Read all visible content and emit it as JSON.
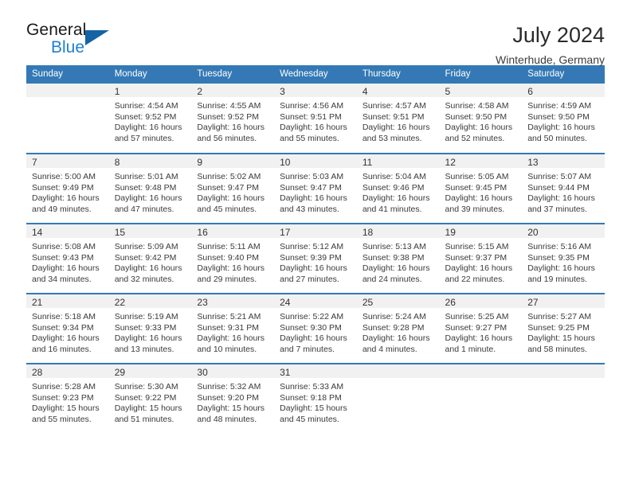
{
  "brand": {
    "name_part1": "General",
    "name_part2": "Blue",
    "triangle_color": "#1464a5",
    "blue_color": "#1f7fd0"
  },
  "header": {
    "title": "July 2024",
    "subtitle": "Winterhude, Germany"
  },
  "theme": {
    "header_row_bg": "#3479b5",
    "daynum_bg": "#f1f1f1",
    "rule_color": "#3479b5"
  },
  "weekdays": [
    "Sunday",
    "Monday",
    "Tuesday",
    "Wednesday",
    "Thursday",
    "Friday",
    "Saturday"
  ],
  "weeks": [
    [
      {
        "day": "",
        "sunrise": "",
        "sunset": "",
        "daylight_line1": "",
        "daylight_line2": ""
      },
      {
        "day": "1",
        "sunrise": "Sunrise: 4:54 AM",
        "sunset": "Sunset: 9:52 PM",
        "daylight_line1": "Daylight: 16 hours",
        "daylight_line2": "and 57 minutes."
      },
      {
        "day": "2",
        "sunrise": "Sunrise: 4:55 AM",
        "sunset": "Sunset: 9:52 PM",
        "daylight_line1": "Daylight: 16 hours",
        "daylight_line2": "and 56 minutes."
      },
      {
        "day": "3",
        "sunrise": "Sunrise: 4:56 AM",
        "sunset": "Sunset: 9:51 PM",
        "daylight_line1": "Daylight: 16 hours",
        "daylight_line2": "and 55 minutes."
      },
      {
        "day": "4",
        "sunrise": "Sunrise: 4:57 AM",
        "sunset": "Sunset: 9:51 PM",
        "daylight_line1": "Daylight: 16 hours",
        "daylight_line2": "and 53 minutes."
      },
      {
        "day": "5",
        "sunrise": "Sunrise: 4:58 AM",
        "sunset": "Sunset: 9:50 PM",
        "daylight_line1": "Daylight: 16 hours",
        "daylight_line2": "and 52 minutes."
      },
      {
        "day": "6",
        "sunrise": "Sunrise: 4:59 AM",
        "sunset": "Sunset: 9:50 PM",
        "daylight_line1": "Daylight: 16 hours",
        "daylight_line2": "and 50 minutes."
      }
    ],
    [
      {
        "day": "7",
        "sunrise": "Sunrise: 5:00 AM",
        "sunset": "Sunset: 9:49 PM",
        "daylight_line1": "Daylight: 16 hours",
        "daylight_line2": "and 49 minutes."
      },
      {
        "day": "8",
        "sunrise": "Sunrise: 5:01 AM",
        "sunset": "Sunset: 9:48 PM",
        "daylight_line1": "Daylight: 16 hours",
        "daylight_line2": "and 47 minutes."
      },
      {
        "day": "9",
        "sunrise": "Sunrise: 5:02 AM",
        "sunset": "Sunset: 9:47 PM",
        "daylight_line1": "Daylight: 16 hours",
        "daylight_line2": "and 45 minutes."
      },
      {
        "day": "10",
        "sunrise": "Sunrise: 5:03 AM",
        "sunset": "Sunset: 9:47 PM",
        "daylight_line1": "Daylight: 16 hours",
        "daylight_line2": "and 43 minutes."
      },
      {
        "day": "11",
        "sunrise": "Sunrise: 5:04 AM",
        "sunset": "Sunset: 9:46 PM",
        "daylight_line1": "Daylight: 16 hours",
        "daylight_line2": "and 41 minutes."
      },
      {
        "day": "12",
        "sunrise": "Sunrise: 5:05 AM",
        "sunset": "Sunset: 9:45 PM",
        "daylight_line1": "Daylight: 16 hours",
        "daylight_line2": "and 39 minutes."
      },
      {
        "day": "13",
        "sunrise": "Sunrise: 5:07 AM",
        "sunset": "Sunset: 9:44 PM",
        "daylight_line1": "Daylight: 16 hours",
        "daylight_line2": "and 37 minutes."
      }
    ],
    [
      {
        "day": "14",
        "sunrise": "Sunrise: 5:08 AM",
        "sunset": "Sunset: 9:43 PM",
        "daylight_line1": "Daylight: 16 hours",
        "daylight_line2": "and 34 minutes."
      },
      {
        "day": "15",
        "sunrise": "Sunrise: 5:09 AM",
        "sunset": "Sunset: 9:42 PM",
        "daylight_line1": "Daylight: 16 hours",
        "daylight_line2": "and 32 minutes."
      },
      {
        "day": "16",
        "sunrise": "Sunrise: 5:11 AM",
        "sunset": "Sunset: 9:40 PM",
        "daylight_line1": "Daylight: 16 hours",
        "daylight_line2": "and 29 minutes."
      },
      {
        "day": "17",
        "sunrise": "Sunrise: 5:12 AM",
        "sunset": "Sunset: 9:39 PM",
        "daylight_line1": "Daylight: 16 hours",
        "daylight_line2": "and 27 minutes."
      },
      {
        "day": "18",
        "sunrise": "Sunrise: 5:13 AM",
        "sunset": "Sunset: 9:38 PM",
        "daylight_line1": "Daylight: 16 hours",
        "daylight_line2": "and 24 minutes."
      },
      {
        "day": "19",
        "sunrise": "Sunrise: 5:15 AM",
        "sunset": "Sunset: 9:37 PM",
        "daylight_line1": "Daylight: 16 hours",
        "daylight_line2": "and 22 minutes."
      },
      {
        "day": "20",
        "sunrise": "Sunrise: 5:16 AM",
        "sunset": "Sunset: 9:35 PM",
        "daylight_line1": "Daylight: 16 hours",
        "daylight_line2": "and 19 minutes."
      }
    ],
    [
      {
        "day": "21",
        "sunrise": "Sunrise: 5:18 AM",
        "sunset": "Sunset: 9:34 PM",
        "daylight_line1": "Daylight: 16 hours",
        "daylight_line2": "and 16 minutes."
      },
      {
        "day": "22",
        "sunrise": "Sunrise: 5:19 AM",
        "sunset": "Sunset: 9:33 PM",
        "daylight_line1": "Daylight: 16 hours",
        "daylight_line2": "and 13 minutes."
      },
      {
        "day": "23",
        "sunrise": "Sunrise: 5:21 AM",
        "sunset": "Sunset: 9:31 PM",
        "daylight_line1": "Daylight: 16 hours",
        "daylight_line2": "and 10 minutes."
      },
      {
        "day": "24",
        "sunrise": "Sunrise: 5:22 AM",
        "sunset": "Sunset: 9:30 PM",
        "daylight_line1": "Daylight: 16 hours",
        "daylight_line2": "and 7 minutes."
      },
      {
        "day": "25",
        "sunrise": "Sunrise: 5:24 AM",
        "sunset": "Sunset: 9:28 PM",
        "daylight_line1": "Daylight: 16 hours",
        "daylight_line2": "and 4 minutes."
      },
      {
        "day": "26",
        "sunrise": "Sunrise: 5:25 AM",
        "sunset": "Sunset: 9:27 PM",
        "daylight_line1": "Daylight: 16 hours",
        "daylight_line2": "and 1 minute."
      },
      {
        "day": "27",
        "sunrise": "Sunrise: 5:27 AM",
        "sunset": "Sunset: 9:25 PM",
        "daylight_line1": "Daylight: 15 hours",
        "daylight_line2": "and 58 minutes."
      }
    ],
    [
      {
        "day": "28",
        "sunrise": "Sunrise: 5:28 AM",
        "sunset": "Sunset: 9:23 PM",
        "daylight_line1": "Daylight: 15 hours",
        "daylight_line2": "and 55 minutes."
      },
      {
        "day": "29",
        "sunrise": "Sunrise: 5:30 AM",
        "sunset": "Sunset: 9:22 PM",
        "daylight_line1": "Daylight: 15 hours",
        "daylight_line2": "and 51 minutes."
      },
      {
        "day": "30",
        "sunrise": "Sunrise: 5:32 AM",
        "sunset": "Sunset: 9:20 PM",
        "daylight_line1": "Daylight: 15 hours",
        "daylight_line2": "and 48 minutes."
      },
      {
        "day": "31",
        "sunrise": "Sunrise: 5:33 AM",
        "sunset": "Sunset: 9:18 PM",
        "daylight_line1": "Daylight: 15 hours",
        "daylight_line2": "and 45 minutes."
      },
      {
        "day": "",
        "sunrise": "",
        "sunset": "",
        "daylight_line1": "",
        "daylight_line2": ""
      },
      {
        "day": "",
        "sunrise": "",
        "sunset": "",
        "daylight_line1": "",
        "daylight_line2": ""
      },
      {
        "day": "",
        "sunrise": "",
        "sunset": "",
        "daylight_line1": "",
        "daylight_line2": ""
      }
    ]
  ]
}
